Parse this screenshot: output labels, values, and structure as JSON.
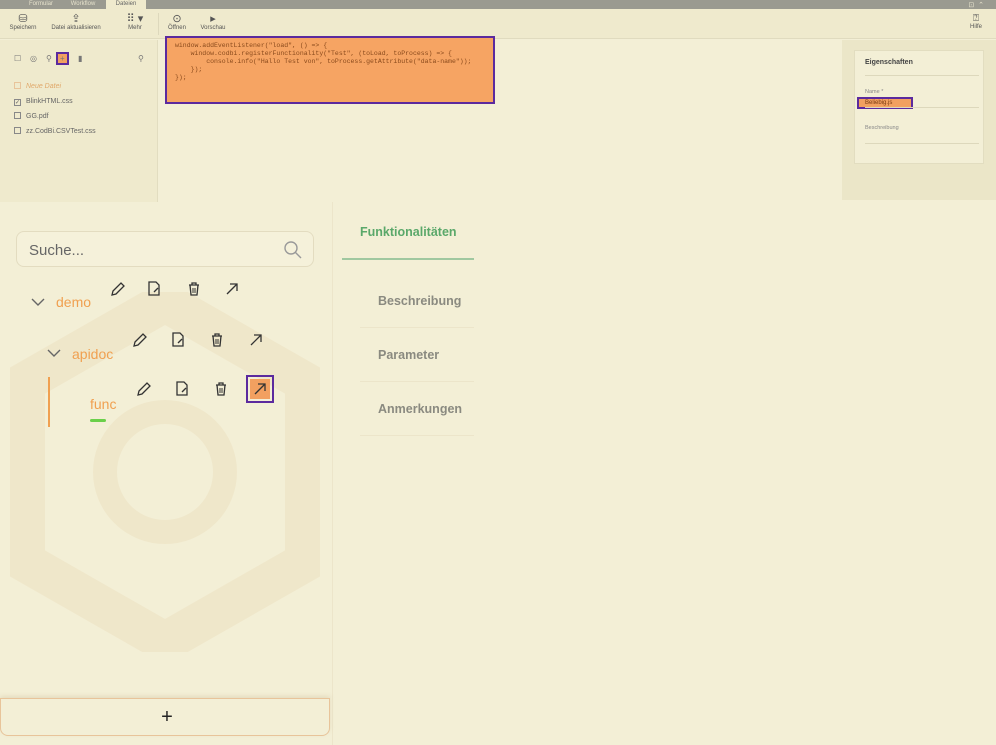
{
  "tabs": [
    {
      "label": "Formular"
    },
    {
      "label": "Workflow"
    },
    {
      "label": "Dateien"
    }
  ],
  "toolbar": {
    "save_label": "Speichern",
    "upload_label": "Datei aktualisieren",
    "more_label": "Mehr",
    "open_label": "Öffnen",
    "preview_label": "Vorschau",
    "help_label": "Hilfe"
  },
  "files": {
    "new_file_label": "Neue Datei",
    "items": [
      {
        "name": "BlinkHTML.css",
        "checked": true
      },
      {
        "name": "GG.pdf",
        "checked": false
      },
      {
        "name": "zz.CodBi.CSVTest.css",
        "checked": false
      }
    ]
  },
  "editor": {
    "code_lines": [
      "window.addEventListener(\"load\", () => {",
      "    window.codbi.registerFunctionality(\"Test\", (toLoad, toProcess) => {",
      "        console.info(\"Hallo Test von\", toProcess.getAttribute(\"data-name\"));",
      "    });",
      "});"
    ]
  },
  "properties": {
    "title": "Eigenschaften",
    "name_label": "Name *",
    "name_value": "Beliebig.js",
    "description_label": "Beschreibung"
  },
  "overlay": {
    "search_placeholder": "Suche...",
    "tree": [
      {
        "label": "demo"
      },
      {
        "label": "apidoc"
      },
      {
        "label": "func"
      }
    ],
    "nav": [
      {
        "label": "Funktionalitäten"
      },
      {
        "label": "Beschreibung"
      },
      {
        "label": "Parameter"
      },
      {
        "label": "Anmerkungen"
      }
    ],
    "add_label": "+"
  },
  "colors": {
    "accent_orange": "#f0a050",
    "selection_purple": "#5b2a9e",
    "active_green": "#5aa86a",
    "background": "#f3efd6"
  }
}
